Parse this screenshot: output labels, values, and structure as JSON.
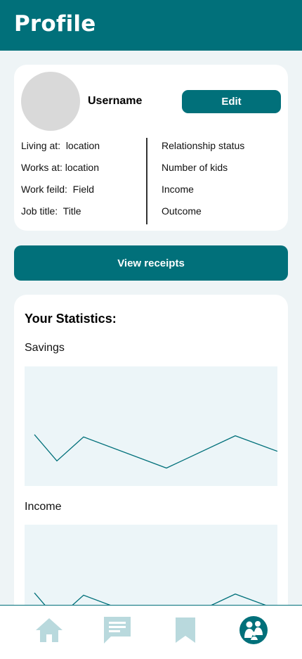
{
  "header": {
    "title": "Profile"
  },
  "profile": {
    "username": "Username",
    "edit_label": "Edit",
    "left_info": [
      "Living at:  location",
      "Works at: location",
      "Work feild:  Field",
      "Job title:  Title"
    ],
    "right_info": [
      "Relationship status",
      "Number of kids",
      "Income",
      "Outcome"
    ]
  },
  "receipts_button": {
    "label": "View receipts"
  },
  "statistics": {
    "title": "Your Statistics:",
    "charts": [
      {
        "label": "Savings",
        "color": "#01707a"
      },
      {
        "label": "Income",
        "color": "#01707a"
      }
    ]
  },
  "chart_data": [
    {
      "type": "line",
      "title": "Savings",
      "xlabel": "",
      "ylabel": "",
      "x": [
        0,
        1,
        2,
        3,
        4,
        5
      ],
      "y": [
        0.57,
        0.79,
        0.59,
        0.85,
        0.58,
        0.71
      ]
    },
    {
      "type": "line",
      "title": "Income",
      "xlabel": "",
      "ylabel": "",
      "x": [
        0,
        1,
        2,
        3,
        4,
        5
      ],
      "y": [
        0.57,
        0.79,
        0.59,
        0.85,
        0.58,
        0.71
      ]
    }
  ],
  "bottom_nav": {
    "items": [
      {
        "icon": "home-icon",
        "color": "#b9d9dd"
      },
      {
        "icon": "chat-icon",
        "color": "#b9d9dd"
      },
      {
        "icon": "bookmark-icon",
        "color": "#b9d9dd"
      },
      {
        "icon": "family-profile-icon",
        "color": "#01707a",
        "active": true
      }
    ]
  }
}
